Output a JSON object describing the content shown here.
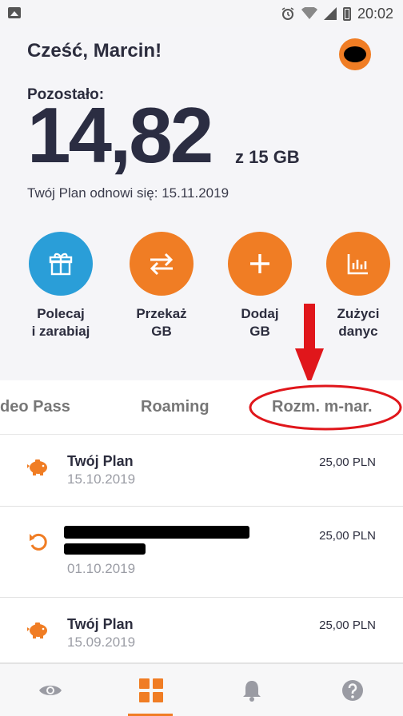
{
  "status_bar": {
    "time": "20:02"
  },
  "header": {
    "greeting": "Cześć, Marcin!"
  },
  "balance": {
    "label": "Pozostało:",
    "value": "14,82",
    "unit": "z 15 GB",
    "renewal": "Twój Plan odnowi się: 15.11.2019"
  },
  "actions": [
    {
      "label": "Polecaj\ni zarabiaj",
      "icon": "gift-icon",
      "color": "#2a9ed8"
    },
    {
      "label": "Przekaż\nGB",
      "icon": "transfer-icon",
      "color": "#f07d24"
    },
    {
      "label": "Dodaj\nGB",
      "icon": "plus-icon",
      "color": "#f07d24"
    },
    {
      "label": "Zużyci\ndanyc",
      "icon": "chart-icon",
      "color": "#f07d24"
    }
  ],
  "tabs": [
    "deo Pass",
    "Roaming",
    "Rozm. m-nar."
  ],
  "transactions": [
    {
      "title": "Twój Plan",
      "date": "15.10.2019",
      "amount": "25,00 PLN",
      "icon": "piggy-bank-icon"
    },
    {
      "title": "",
      "date": "01.10.2019",
      "amount": "25,00 PLN",
      "icon": "refresh-icon"
    },
    {
      "title": "Twój Plan",
      "date": "15.09.2019",
      "amount": "25,00 PLN",
      "icon": "piggy-bank-icon"
    }
  ],
  "nav": [
    {
      "icon": "eye-icon"
    },
    {
      "icon": "grid-icon"
    },
    {
      "icon": "bell-icon"
    },
    {
      "icon": "help-icon"
    }
  ],
  "colors": {
    "accent": "#f07d24",
    "blue": "#2a9ed8",
    "text": "#2c2d3e",
    "annotation": "#e0161b"
  }
}
